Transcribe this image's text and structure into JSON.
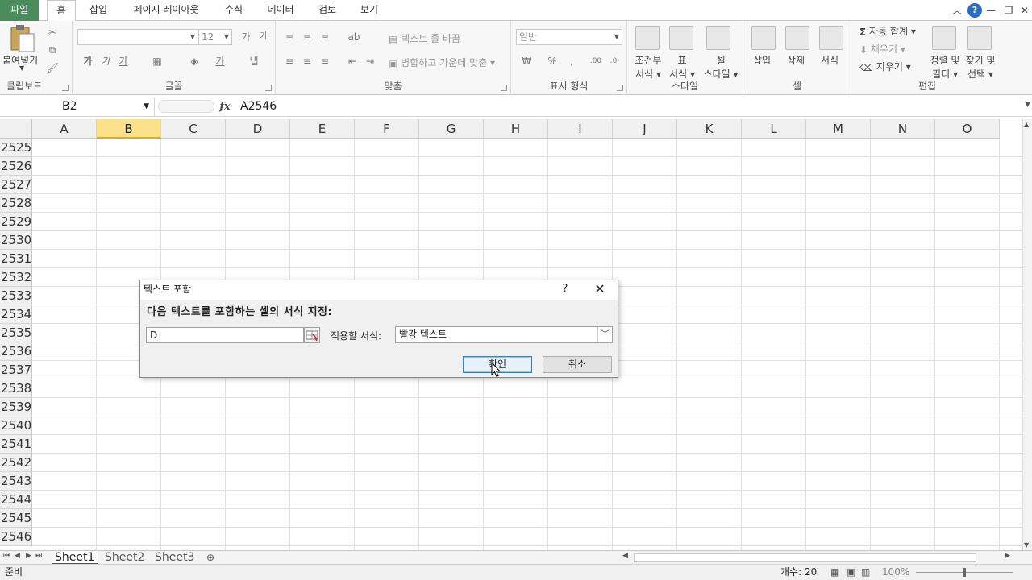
{
  "tabs": [
    "파일",
    "홈",
    "삽입",
    "페이지 레이아웃",
    "수식",
    "데이터",
    "검토",
    "보기"
  ],
  "ribbon": {
    "clipboard": {
      "paste": "붙여넣기",
      "label": "클립보드"
    },
    "font": {
      "size": "12",
      "label": "글꼴",
      "bold": "가",
      "italic": "가",
      "underline": "가"
    },
    "align": {
      "wrap": "텍스트 줄 바꿈",
      "merge": "병합하고 가운데 맞춤",
      "label": "맞춤"
    },
    "number": {
      "format": "일반",
      "label": "표시 형식",
      "percent": "%",
      "comma": ","
    },
    "styles": {
      "cond": "조건부",
      "cond2": "서식",
      "table": "표",
      "table2": "서식",
      "cell": "셀",
      "cell2": "스타일",
      "label": "스타일"
    },
    "cells": {
      "insert": "삽입",
      "delete": "삭제",
      "format": "서식",
      "label": "셀"
    },
    "edit": {
      "autosum": "자동 합계",
      "fill": "채우기",
      "clear": "지우기",
      "sort": "정렬 및",
      "sort2": "필터",
      "find": "찾기 및",
      "find2": "선택",
      "label": "편집"
    }
  },
  "formula_bar": {
    "name_box": "B2",
    "fx": "fx",
    "content": "A2546"
  },
  "columns": [
    "A",
    "B",
    "C",
    "D",
    "E",
    "F",
    "G",
    "H",
    "I",
    "J",
    "K",
    "L",
    "M",
    "N",
    "O"
  ],
  "selected_column": "B",
  "rows": [
    "2525",
    "2526",
    "2527",
    "2528",
    "2529",
    "2530",
    "2531",
    "2532",
    "2533",
    "2534",
    "2535",
    "2536",
    "2537",
    "2538",
    "2539",
    "2540",
    "2541",
    "2542",
    "2543",
    "2544",
    "2545",
    "2546"
  ],
  "sheets": [
    "Sheet1",
    "Sheet2",
    "Sheet3"
  ],
  "status": {
    "ready": "준비",
    "count": "개수: 20",
    "zoom": "100%"
  },
  "dialog": {
    "title": "텍스트 포함",
    "help": "?",
    "heading": "다음 텍스트를 포함하는 셀의 서식 지정:",
    "input_value": "D",
    "format_label": "적용할 서식:",
    "format_value": "빨강 텍스트",
    "ok": "확인",
    "cancel": "취소"
  }
}
